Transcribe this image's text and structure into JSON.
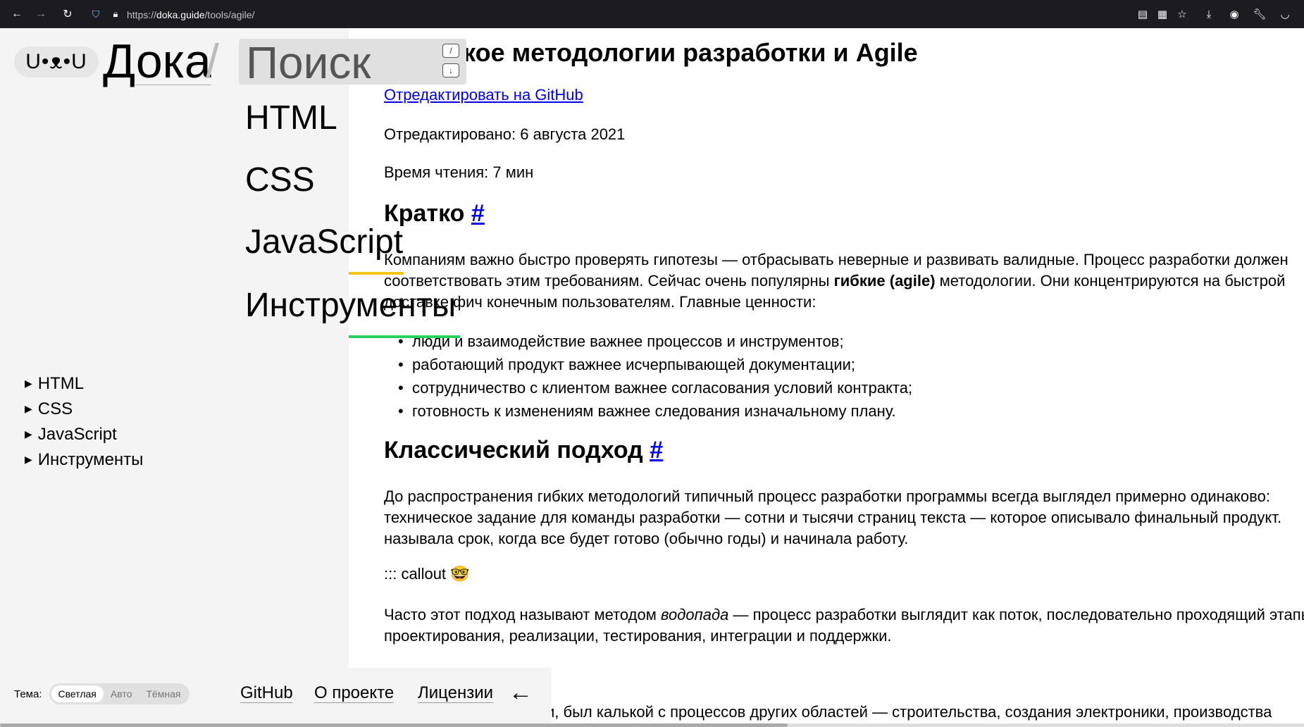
{
  "browser": {
    "url_prefix": "https://",
    "url_host": "doka.guide",
    "url_path": "/tools/agile/"
  },
  "header": {
    "logo": "U•ᴥ•U",
    "site_name": "Дока",
    "slash": "/",
    "search_label": "Поиск",
    "kbd_top": "/",
    "kbd_bottom": "↓"
  },
  "big_nav": [
    "HTML",
    "CSS",
    "JavaScript",
    "Инструменты"
  ],
  "tree": [
    "HTML",
    "CSS",
    "JavaScript",
    "Инструменты"
  ],
  "theme": {
    "label": "Тема:",
    "options": [
      "Светлая",
      "Авто",
      "Тёмная"
    ],
    "selected": "Светлая"
  },
  "footer": {
    "links": [
      "GitHub",
      "О проекте",
      "Лицензии"
    ],
    "arrow": "←"
  },
  "article": {
    "title": "Что такое методологии разработки и Agile",
    "edit_link": "Отредактировать на GitHub",
    "edited": "Отредактировано: 6 августа 2021",
    "reading_time": "Время чтения: 7 мин",
    "h_short": "Кратко",
    "anchor": "#",
    "p1_line1": "Компаниям важно быстро проверять гипотезы — отбрасывать неверные и развивать валидные. Процесс разработки должен",
    "p1_line2_a": "соответствовать этим требованиям. Сейчас очень популярны ",
    "p1_line2_b": "гибкие (agile)",
    "p1_line2_c": " методологии. Они концентрируются на быстрой",
    "p1_line3": "доставке фич конечным пользователям. Главные ценности:",
    "bullets": [
      "люди и взаимодействие важнее процессов и инструментов;",
      "работающий продукт важнее исчерпывающей документации;",
      "сотрудничество с клиентом важнее согласования условий контракта;",
      "готовность к изменениям важнее следования изначальному плану."
    ],
    "h_classic": "Классический подход",
    "p2_line1": "До распространения гибких методологий типичный процесс разработки программы всегда выглядел примерно одинаково:",
    "p2_line2": "техническое задание для команды разработки — сотни и тысячи страниц текста — которое описывало финальный продукт.",
    "p2_line3": "называла срок, когда все будет готово (обычно годы) и начинала работу.",
    "callout": "::: callout 🤓",
    "p3_line1_a": "Часто этот подход называют методом ",
    "p3_line1_b": "водопада",
    "p3_line1_c": " — процесс разработки выглядит как поток, последовательно проходящий этапы",
    "p3_line2": "проектирования, реализации, тестирования, интеграции и поддержки.",
    "p4_fragment": "и, был калькой с процессов других областей — строительства, создания электроники, производства"
  }
}
